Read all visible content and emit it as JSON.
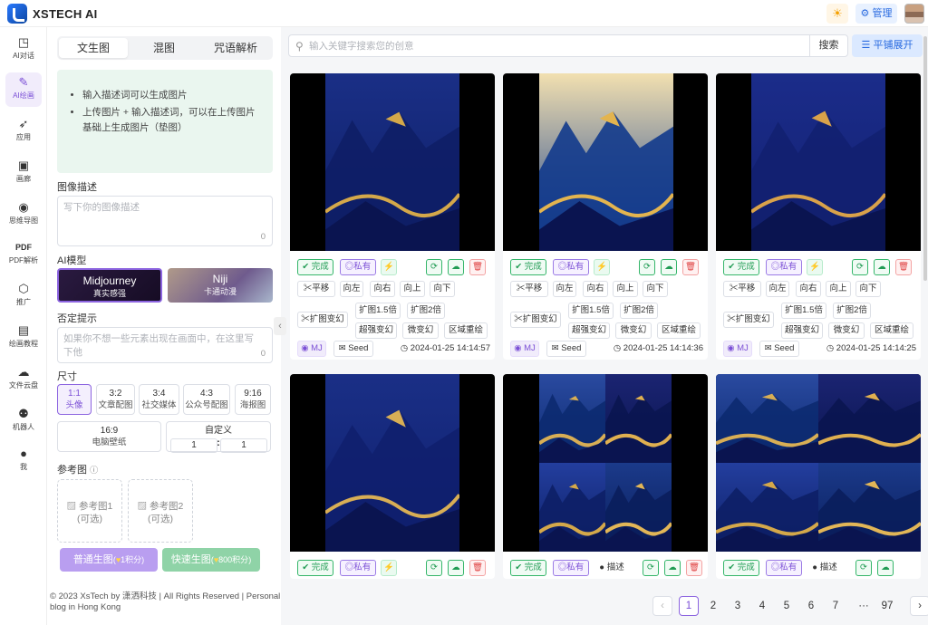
{
  "app": {
    "brand": "XSTECH AI",
    "admin_label": "管理"
  },
  "nav": [
    {
      "icon": "chat-bubble-icon",
      "label": "AI对话"
    },
    {
      "icon": "paint-brush-icon",
      "label": "AI绘画"
    },
    {
      "icon": "rocket-icon",
      "label": "应用"
    },
    {
      "icon": "gallery-icon",
      "label": "画廊"
    },
    {
      "icon": "mind-map-icon",
      "label": "思维导图"
    },
    {
      "icon": "pdf-icon",
      "label": "PDF解析"
    },
    {
      "icon": "handshake-icon",
      "label": "推广"
    },
    {
      "icon": "book-icon",
      "label": "绘画教程"
    },
    {
      "icon": "cloud-folder-icon",
      "label": "文件云盘"
    },
    {
      "icon": "robot-icon",
      "label": "机器人"
    },
    {
      "icon": "user-icon",
      "label": "我"
    }
  ],
  "panel": {
    "tabs": [
      "文生图",
      "混图",
      "咒语解析"
    ],
    "tips": [
      "输入描述词可以生成图片",
      "上传图片 + 输入描述词，可以在上传图片基础上生成图片（垫图）"
    ],
    "prompt_label": "图像描述",
    "prompt_placeholder": "写下你的图像描述",
    "prompt_count": "0",
    "model_label": "AI模型",
    "models": [
      {
        "name": "Midjourney",
        "sub": "真实感强"
      },
      {
        "name": "Niji",
        "sub": "卡通动漫"
      }
    ],
    "negative_label": "否定提示",
    "negative_placeholder": "如果你不想一些元素出现在画面中，在这里写下他",
    "negative_count": "0",
    "size_label": "尺寸",
    "ratios": [
      {
        "value": "1:1",
        "name": "头像"
      },
      {
        "value": "3:2",
        "name": "文章配图"
      },
      {
        "value": "3:4",
        "name": "社交媒体"
      },
      {
        "value": "4:3",
        "name": "公众号配图"
      },
      {
        "value": "9:16",
        "name": "海报图"
      },
      {
        "value": "16:9",
        "name": "电脑壁纸"
      }
    ],
    "custom_label": "自定义",
    "custom_w": "1",
    "custom_h": "1",
    "custom_sep": ":",
    "ref_label": "参考图",
    "refs": [
      {
        "label": "参考图1",
        "sub": "(可选)"
      },
      {
        "label": "参考图2",
        "sub": "(可选)"
      }
    ],
    "btn_normal": "普通生图",
    "btn_normal_pts": "1积分",
    "btn_fast": "快速生图",
    "btn_fast_pts": "800积分"
  },
  "footer": "© 2023 XsTech by 潇洒科技 | All Rights Reserved | Personal blog in Hong Kong",
  "search": {
    "placeholder": "输入关键字搜索您的创意",
    "button": "搜索",
    "expand": "平铺展开"
  },
  "chips": {
    "done": "完成",
    "private": "私有",
    "describe": "描述",
    "pan": "平移",
    "left": "向左",
    "right": "向右",
    "up": "向上",
    "down": "向下",
    "expand": "扩图变幻",
    "x15": "扩图1.5倍",
    "x2": "扩图2倍",
    "super": "超强变幻",
    "micro": "微变幻",
    "region": "区域重绘",
    "mj": "MJ",
    "seed": "Seed"
  },
  "cards": [
    {
      "time": "2024-01-25 14:14:57",
      "palette": {
        "sky": "#1a2f86",
        "fg": "#0e1e66",
        "gold": "#d4a84a"
      }
    },
    {
      "time": "2024-01-25 14:14:36",
      "palette": {
        "sky": "#f2e0b0",
        "fg": "#123a8c",
        "gold": "#e3b44f"
      }
    },
    {
      "time": "2024-01-25 14:14:25",
      "palette": {
        "sky": "#1b2c8a",
        "fg": "#122070",
        "gold": "#d9a24a"
      }
    }
  ],
  "pager": {
    "pages": [
      "1",
      "2",
      "3",
      "4",
      "5",
      "6",
      "7",
      "···",
      "97"
    ],
    "current": "1",
    "prev": "‹",
    "next": "›"
  }
}
